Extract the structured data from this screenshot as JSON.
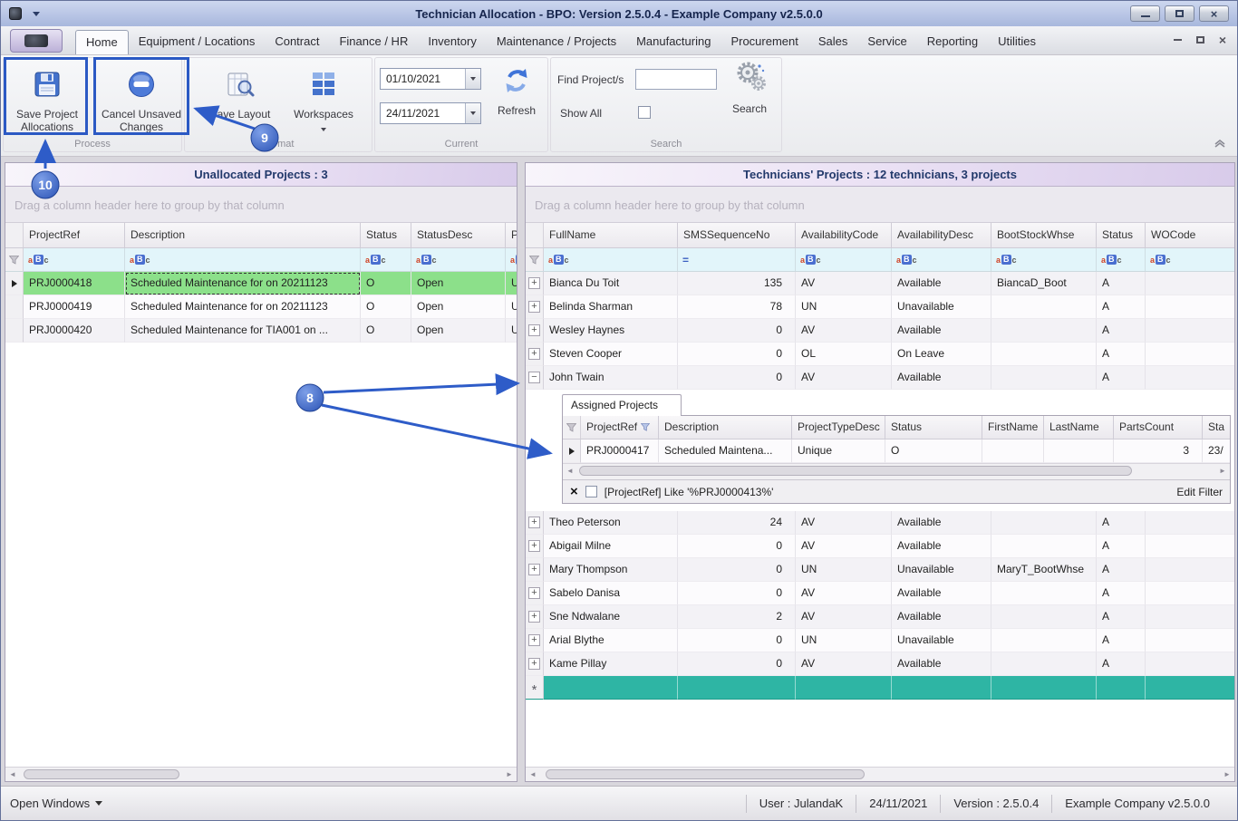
{
  "titlebar": {
    "title": "Technician Allocation - BPO: Version 2.5.0.4 - Example Company v2.5.0.0"
  },
  "tabstrip": {
    "tabs": [
      {
        "label": "Home",
        "cls": "active"
      },
      {
        "label": "Equipment / Locations"
      },
      {
        "label": "Contract"
      },
      {
        "label": "Finance / HR"
      },
      {
        "label": "Inventory"
      },
      {
        "label": "Maintenance / Projects"
      },
      {
        "label": "Manufacturing"
      },
      {
        "label": "Procurement"
      },
      {
        "label": "Sales"
      },
      {
        "label": "Service"
      },
      {
        "label": "Reporting"
      },
      {
        "label": "Utilities"
      }
    ]
  },
  "ribbon": {
    "save_project": "Save Project Allocations",
    "cancel_unsaved": "Cancel Unsaved Changes",
    "save_layout": "Save Layout",
    "workspaces": "Workspaces",
    "date_from": "01/10/2021",
    "date_to": "24/11/2021",
    "refresh": "Refresh",
    "find_label": "Find Project/s",
    "find_value": "",
    "show_all": "Show All",
    "search": "Search",
    "groups": {
      "process": "Process",
      "format": "Format",
      "current": "Current",
      "search": "Search"
    }
  },
  "left": {
    "title": "Unallocated Projects : 3",
    "drag_hint": "Drag a column header here to group by that column",
    "columns": [
      "ProjectRef",
      "Description",
      "Status",
      "StatusDesc",
      "Pre"
    ],
    "rows": [
      {
        "ref": "PRJ0000418",
        "desc": "Scheduled Maintenance for  on 20211123",
        "status": "O",
        "statusdesc": "Open",
        "pre": "Un",
        "cls": "selected"
      },
      {
        "ref": "PRJ0000419",
        "desc": "Scheduled Maintenance for  on 20211123",
        "status": "O",
        "statusdesc": "Open",
        "pre": "Un"
      },
      {
        "ref": "PRJ0000420",
        "desc": "Scheduled Maintenance for TIA001 on ...",
        "status": "O",
        "statusdesc": "Open",
        "pre": "Un"
      }
    ]
  },
  "right": {
    "title": "Technicians' Projects : 12 technicians, 3 projects",
    "drag_hint": "Drag a column header here to group by that column",
    "columns": [
      "FullName",
      "SMSSequenceNo",
      "AvailabilityCode",
      "AvailabilityDesc",
      "BootStockWhse",
      "Status",
      "WOCode"
    ],
    "rows_top": [
      {
        "exp": "+",
        "name": "Bianca Du Toit",
        "sms": "135",
        "acode": "AV",
        "adesc": "Available",
        "whse": "BiancaD_Boot",
        "status": "A",
        "wocode": ""
      },
      {
        "exp": "+",
        "name": "Belinda Sharman",
        "sms": "78",
        "acode": "UN",
        "adesc": "Unavailable",
        "whse": "",
        "status": "A",
        "wocode": ""
      },
      {
        "exp": "+",
        "name": "Wesley Haynes",
        "sms": "0",
        "acode": "AV",
        "adesc": "Available",
        "whse": "",
        "status": "A",
        "wocode": ""
      },
      {
        "exp": "+",
        "name": "Steven Cooper",
        "sms": "0",
        "acode": "OL",
        "adesc": "On Leave",
        "whse": "",
        "status": "A",
        "wocode": ""
      },
      {
        "exp": "−",
        "name": "John Twain",
        "sms": "0",
        "acode": "AV",
        "adesc": "Available",
        "whse": "",
        "status": "A",
        "wocode": "",
        "cls": "expanded"
      }
    ],
    "rows_bottom": [
      {
        "exp": "+",
        "name": "Theo Peterson",
        "sms": "24",
        "acode": "AV",
        "adesc": "Available",
        "whse": "",
        "status": "A",
        "wocode": ""
      },
      {
        "exp": "+",
        "name": "Abigail Milne",
        "sms": "0",
        "acode": "AV",
        "adesc": "Available",
        "whse": "",
        "status": "A",
        "wocode": ""
      },
      {
        "exp": "+",
        "name": "Mary Thompson",
        "sms": "0",
        "acode": "UN",
        "adesc": "Unavailable",
        "whse": "MaryT_BootWhse",
        "status": "A",
        "wocode": ""
      },
      {
        "exp": "+",
        "name": "Sabelo Danisa",
        "sms": "0",
        "acode": "AV",
        "adesc": "Available",
        "whse": "",
        "status": "A",
        "wocode": ""
      },
      {
        "exp": "+",
        "name": "Sne Ndwalane",
        "sms": "2",
        "acode": "AV",
        "adesc": "Available",
        "whse": "",
        "status": "A",
        "wocode": ""
      },
      {
        "exp": "+",
        "name": "Arial Blythe",
        "sms": "0",
        "acode": "UN",
        "adesc": "Unavailable",
        "whse": "",
        "status": "A",
        "wocode": ""
      },
      {
        "exp": "+",
        "name": "Kame Pillay",
        "sms": "0",
        "acode": "AV",
        "adesc": "Available",
        "whse": "",
        "status": "A",
        "wocode": ""
      }
    ],
    "detail": {
      "tab": "Assigned Projects",
      "columns": [
        "ProjectRef",
        "Description",
        "ProjectTypeDesc",
        "Status",
        "FirstName",
        "LastName",
        "PartsCount",
        "Sta"
      ],
      "row": {
        "ref": "PRJ0000417",
        "desc": "Scheduled Maintena...",
        "type": "Unique",
        "status": "O",
        "first": "",
        "last": "",
        "parts": "3",
        "sta": "23/"
      },
      "filter_text": "[ProjectRef] Like '%PRJ0000413%'",
      "edit_filter": "Edit Filter"
    }
  },
  "statusbar": {
    "open_windows": "Open Windows",
    "user": "User : JulandaK",
    "date": "24/11/2021",
    "version": "Version : 2.5.0.4",
    "company": "Example Company v2.5.0.0"
  },
  "annotations": {
    "n8": "8",
    "n9": "9",
    "n10": "10"
  },
  "icons": {
    "abc": [
      "a",
      "B",
      "c"
    ],
    "equals": "=",
    "append": "*",
    "close_filter": "×",
    "close_window": "×",
    "sb_left": "◄",
    "sb_right": "►",
    "collapse_ribbon": "^"
  }
}
